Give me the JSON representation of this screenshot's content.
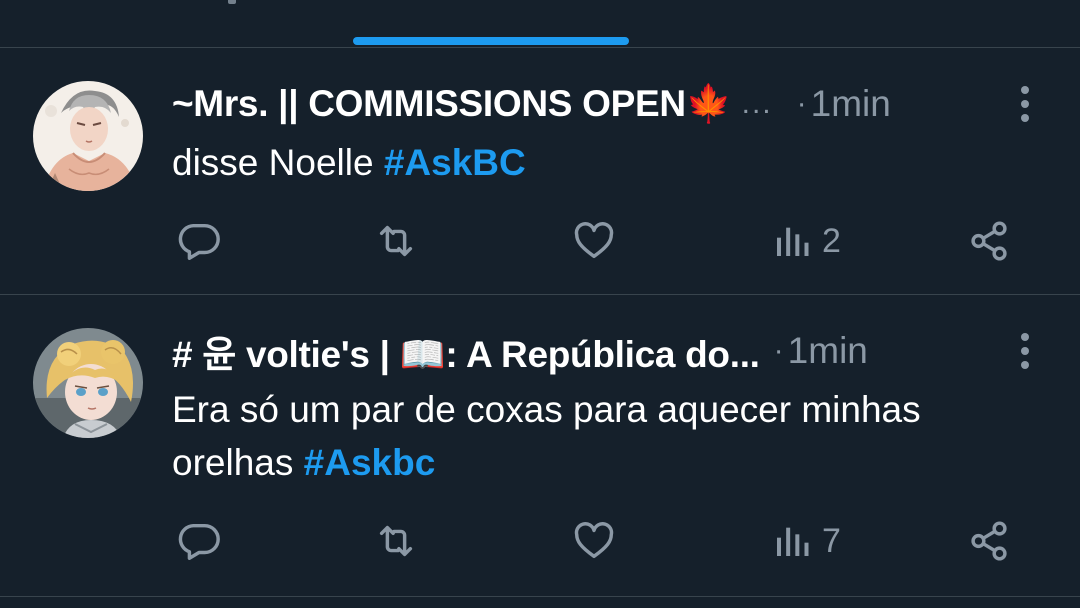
{
  "feed": {
    "active_tab_color": "#1d9bf0",
    "tweets": [
      {
        "name": "~Mrs. || COMMISSIONS OPEN🍁",
        "name_truncation": "...",
        "separator": "·",
        "time": "1min",
        "text_plain": "disse Noelle ",
        "hashtag": "#AskBC",
        "views": "2",
        "avatar_icon": "anime-character-avatar"
      },
      {
        "name": "# 윤 voltie's | 📖: A República do...",
        "separator": "·",
        "time": "1min",
        "text_plain": "Era só um par de coxas para aquecer minhas orelhas ",
        "hashtag": "#Askbc",
        "views": "7",
        "avatar_icon": "blonde-character-avatar"
      }
    ]
  },
  "icons": {
    "reply": "reply-icon",
    "retweet": "retweet-icon",
    "like": "heart-icon",
    "views": "views-chart-icon",
    "share": "share-icon",
    "more": "more-vertical-icon"
  },
  "colors": {
    "background": "#15202b",
    "divider": "#38444d",
    "secondary_text": "#8b98a5",
    "accent": "#1d9bf0"
  }
}
